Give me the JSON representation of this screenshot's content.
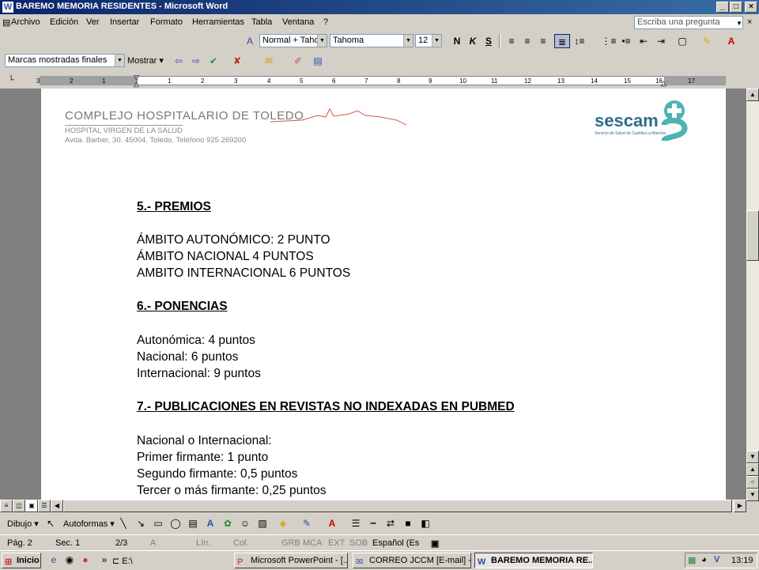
{
  "window": {
    "title": "BAREMO MEMORIA RESIDENTES - Microsoft Word",
    "min": "_",
    "max": "□",
    "close": "×"
  },
  "menu": {
    "items": [
      "Archivo",
      "Edición",
      "Ver",
      "Insertar",
      "Formato",
      "Herramientas",
      "Tabla",
      "Ventana",
      "?"
    ],
    "ask_placeholder": "Escriba una pregunta"
  },
  "formatting": {
    "style": "Normal + Tahor",
    "font": "Tahoma",
    "size": "12",
    "bold": "N",
    "italic": "K",
    "underline": "S"
  },
  "reviewing": {
    "display": "Marcas mostradas finales",
    "show": "Mostrar"
  },
  "ruler": {
    "labels": [
      "3",
      "2",
      "1",
      "1",
      "2",
      "3",
      "4",
      "5",
      "6",
      "7",
      "8",
      "9",
      "10",
      "11",
      "12",
      "13",
      "14",
      "15",
      "16",
      "17"
    ]
  },
  "header": {
    "hospital": "COMPLEJO HOSPITALARIO DE TOLEDO",
    "sub": "HOSPITAL VIRGEN DE LA SALUD",
    "address": "Avda. Barber, 30. 45004. Toledo. Teléfono 925 269200",
    "logo": "sescam",
    "logo_sub": "Servicio de Salud de Castilla-La Mancha"
  },
  "document": {
    "s5_title": "5.- PREMIOS",
    "s5_l1": "ÁMBITO AUTONÓMICO: 2 PUNTO",
    "s5_l2": "ÁMBITO NACIONAL 4 PUNTOS",
    "s5_l3": "AMBITO INTERNACIONAL 6 PUNTOS",
    "s6_title": "6.- PONENCIAS",
    "s6_l1": "Autonómica: 4 puntos",
    "s6_l2": "Nacional:  6 puntos",
    "s6_l3": "Internacional: 9 puntos",
    "s7_title": "7.- PUBLICACIONES EN REVISTAS NO INDEXADAS EN PUBMED",
    "s7_l1": "Nacional o Internacional:",
    "s7_l2": "Primer firmante: 1 punto",
    "s7_l3": "Segundo firmante: 0,5 puntos",
    "s7_l4": "Tercer o más firmante: 0,25 puntos"
  },
  "drawing": {
    "draw": "Dibujo",
    "autoshapes": "Autoformas"
  },
  "status": {
    "page": "Pág.  2",
    "section": "Sec.  1",
    "pages": "2/3",
    "at": "A",
    "line": "Lín.",
    "col": "Col.",
    "grb": "GRB",
    "mca": "MCA",
    "ext": "EXT",
    "sob": "SOB",
    "lang": "Español (Es"
  },
  "taskbar": {
    "start": "Inicio",
    "drive": "E:\\",
    "t1": "Microsoft PowerPoint - [...",
    "t2": "CORREO JCCM [E-mail] -...",
    "t3": "BAREMO MEMORIA RE...",
    "clock": "13:19"
  },
  "colors": {
    "titlebar": "#0a246a",
    "chrome": "#d4d0c8",
    "accent_red": "#d9534f",
    "logo_teal": "#4db3b3"
  }
}
